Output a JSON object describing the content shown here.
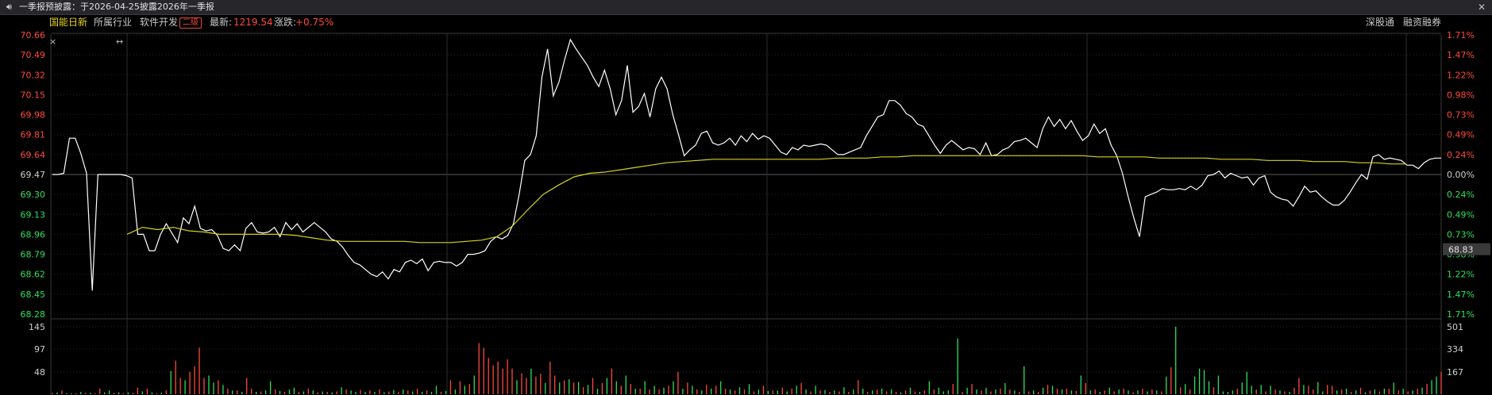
{
  "banner": {
    "speaker_icon": "speaker-icon",
    "text": "一季报预披露：于2026-04-25披露2026年一季报",
    "close_icon": "close-icon"
  },
  "info": {
    "index_name": "国能日新",
    "industry_label": "所属行业",
    "industry_value": "软件开发",
    "level_badge": "二级",
    "latest_label": "最新:",
    "latest_value": "1219.54",
    "change_label": "涨跌:",
    "change_value": "+0.75%",
    "link_sz": "深股通",
    "link_margin": "融资融券"
  },
  "colors": {
    "up": "#ff4a3a",
    "down": "#2ee05a",
    "price_line": "#ffffff",
    "avg_line": "#d6d21e",
    "grid": "#262626"
  },
  "chart_data": [
    {
      "type": "line",
      "title": "",
      "left_ticks": [
        "70.66",
        "70.49",
        "70.32",
        "70.15",
        "69.98",
        "69.81",
        "69.64",
        "69.47",
        "69.30",
        "69.13",
        "68.96",
        "68.79",
        "68.62",
        "68.45",
        "68.28"
      ],
      "right_ticks": [
        "1.71%",
        "1.47%",
        "1.22%",
        "0.98%",
        "0.73%",
        "0.49%",
        "0.24%",
        "0.00%",
        "0.24%",
        "0.49%",
        "0.73%",
        "0.98%",
        "1.22%",
        "1.47%",
        "1.71%"
      ],
      "ylim": [
        68.28,
        70.66
      ],
      "baseline": 69.47,
      "current_value": "68.83",
      "series": [
        {
          "values": [
            69.47,
            69.47,
            69.48,
            69.78,
            69.78,
            69.65,
            69.48,
            68.48,
            69.47,
            69.47,
            69.47,
            69.47,
            69.47,
            69.46,
            69.44,
            68.96,
            68.96,
            68.82,
            68.82,
            68.96,
            69.05,
            68.97,
            68.89,
            69.1,
            69.05,
            69.2,
            69.01,
            68.99,
            69.0,
            68.95,
            68.84,
            68.82,
            68.87,
            68.82,
            69.01,
            69.06,
            68.98,
            68.97,
            68.98,
            69.02,
            68.94,
            69.06,
            69.0,
            69.05,
            68.98,
            69.02,
            69.06,
            69.02,
            68.98,
            68.92,
            68.9,
            68.85,
            68.78,
            68.72,
            68.7,
            68.66,
            68.62,
            68.6,
            68.64,
            68.58,
            68.66,
            68.64,
            68.72,
            68.74,
            68.71,
            68.75,
            68.65,
            68.72,
            68.73,
            68.72,
            68.72,
            68.69,
            68.72,
            68.79,
            68.79,
            68.8,
            68.82,
            68.9,
            68.94,
            68.92,
            68.95,
            69.05,
            69.3,
            69.59,
            69.64,
            69.8,
            70.3,
            70.54,
            70.14,
            70.26,
            70.45,
            70.62,
            70.54,
            70.47,
            70.4,
            70.3,
            70.22,
            70.36,
            70.2,
            69.98,
            70.1,
            70.4,
            70.0,
            70.05,
            70.16,
            69.96,
            70.2,
            70.3,
            70.2,
            69.98,
            69.81,
            69.63,
            69.68,
            69.72,
            69.82,
            69.84,
            69.74,
            69.72,
            69.74,
            69.78,
            69.72,
            69.8,
            69.75,
            69.82,
            69.77,
            69.8,
            69.78,
            69.72,
            69.66,
            69.64,
            69.7,
            69.68,
            69.72,
            69.71,
            69.72,
            69.73,
            69.72,
            69.68,
            69.64,
            69.64,
            69.66,
            69.68,
            69.7,
            69.8,
            69.88,
            69.96,
            69.98,
            70.1,
            70.1,
            70.06,
            69.99,
            69.96,
            69.9,
            69.88,
            69.8,
            69.72,
            69.65,
            69.72,
            69.76,
            69.72,
            69.68,
            69.7,
            69.69,
            69.64,
            69.74,
            69.63,
            69.64,
            69.68,
            69.7,
            69.75,
            69.76,
            69.78,
            69.74,
            69.7,
            69.86,
            69.96,
            69.88,
            69.94,
            69.86,
            69.93,
            69.84,
            69.76,
            69.8,
            69.9,
            69.82,
            69.86,
            69.72,
            69.63,
            69.48,
            69.28,
            69.1,
            68.94,
            69.28,
            69.3,
            69.32,
            69.35,
            69.34,
            69.34,
            69.35,
            69.34,
            69.37,
            69.34,
            69.38,
            69.46,
            69.47,
            69.5,
            69.44,
            69.48,
            69.46,
            69.44,
            69.45,
            69.38,
            69.44,
            69.46,
            69.32,
            69.28,
            69.26,
            69.25,
            69.2,
            69.28,
            69.37,
            69.32,
            69.33,
            69.28,
            69.24,
            69.21,
            69.21,
            69.25,
            69.32,
            69.4,
            69.47,
            69.43,
            69.62,
            69.64,
            69.6,
            69.61,
            69.6,
            69.59,
            69.55,
            69.55,
            69.52,
            69.57,
            69.6,
            69.61,
            69.61
          ],
          "avg_values": [
            68.96,
            69.02,
            69.0,
            69.02,
            68.99,
            68.98,
            68.96,
            68.96,
            68.96,
            68.96,
            68.96,
            68.95,
            68.93,
            68.91,
            68.9,
            68.9,
            68.9,
            68.9,
            68.9,
            68.89,
            68.89,
            68.89,
            68.9,
            68.91,
            68.94,
            69.03,
            69.17,
            69.3,
            69.38,
            69.45,
            69.48,
            69.49,
            69.51,
            69.53,
            69.55,
            69.57,
            69.58,
            69.59,
            69.6,
            69.6,
            69.6,
            69.6,
            69.6,
            69.6,
            69.6,
            69.6,
            69.61,
            69.61,
            69.61,
            69.62,
            69.62,
            69.63,
            69.63,
            69.63,
            69.63,
            69.63,
            69.63,
            69.63,
            69.63,
            69.63,
            69.63,
            69.63,
            69.63,
            69.62,
            69.62,
            69.62,
            69.62,
            69.61,
            69.61,
            69.61,
            69.61,
            69.6,
            69.6,
            69.6,
            69.59,
            69.59,
            69.59,
            69.58,
            69.58,
            69.58,
            69.57,
            69.57,
            69.56,
            69.56
          ]
        }
      ]
    },
    {
      "type": "bar",
      "title": "",
      "left_ticks": [
        "145",
        "97",
        "48"
      ],
      "right_ticks": [
        "501",
        "334",
        "167"
      ],
      "ylim": [
        0,
        150
      ],
      "series": [
        {
          "values": [
            3,
            4,
            8,
            2,
            2,
            2,
            5,
            3,
            3,
            2,
            12,
            4,
            8,
            3,
            4,
            2,
            4,
            3,
            14,
            6,
            12,
            4,
            2,
            3,
            8,
            50,
            72,
            35,
            30,
            48,
            60,
            100,
            35,
            40,
            25,
            30,
            20,
            12,
            8,
            8,
            5,
            35,
            12,
            5,
            6,
            8,
            28,
            10,
            7,
            5,
            10,
            14,
            5,
            6,
            12,
            8,
            4,
            6,
            5,
            4,
            6,
            15,
            10,
            8,
            5,
            9,
            5,
            8,
            5,
            10,
            4,
            6,
            9,
            5,
            10,
            8,
            6,
            12,
            5,
            8,
            5,
            18,
            5,
            7,
            30,
            10,
            28,
            18,
            22,
            40,
            110,
            100,
            78,
            62,
            70,
            55,
            75,
            55,
            30,
            45,
            35,
            55,
            38,
            44,
            24,
            70,
            40,
            25,
            30,
            32,
            25,
            26,
            15,
            20,
            35,
            12,
            24,
            35,
            55,
            28,
            18,
            40,
            22,
            12,
            12,
            28,
            10,
            18,
            10,
            14,
            18,
            28,
            48,
            12,
            25,
            18,
            10,
            8,
            20,
            12,
            18,
            28,
            12,
            10,
            8,
            15,
            10,
            22,
            6,
            10,
            18,
            7,
            8,
            8,
            14,
            6,
            12,
            18,
            24,
            10,
            6,
            18,
            8,
            9,
            5,
            8,
            6,
            15,
            5,
            10,
            30,
            12,
            5,
            8,
            10,
            12,
            6,
            10,
            5,
            4,
            8,
            14,
            6,
            5,
            8,
            28,
            10,
            14,
            6,
            8,
            22,
            120,
            5,
            14,
            22,
            10,
            8,
            14,
            6,
            10,
            12,
            24,
            10,
            8,
            5,
            60,
            6,
            8,
            5,
            14,
            20,
            18,
            12,
            10,
            12,
            8,
            7,
            40,
            24,
            8,
            10,
            5,
            8,
            14,
            6,
            10,
            12,
            8,
            4,
            8,
            12,
            6,
            10,
            8,
            6,
            38,
            58,
            145,
            15,
            22,
            10,
            38,
            55,
            52,
            28,
            15,
            40,
            6,
            5,
            8,
            12,
            25,
            48,
            18,
            10,
            20,
            6,
            18,
            10,
            8,
            6,
            5,
            14,
            35,
            20,
            18,
            10,
            26,
            6,
            20,
            18,
            8,
            10,
            12,
            5,
            8,
            14,
            4,
            8,
            10,
            6,
            12,
            12,
            25,
            8,
            12,
            6,
            8,
            12,
            14,
            22,
            30,
            38,
            48
          ],
          "colors": [
            "u",
            "d",
            "u",
            "d",
            "d",
            "u",
            "d",
            "u",
            "d",
            "u",
            "u",
            "d",
            "d",
            "u",
            "d",
            "u",
            "d",
            "u",
            "u",
            "d",
            "u",
            "d",
            "u",
            "d",
            "u",
            "d",
            "u",
            "u",
            "d",
            "u",
            "u",
            "u",
            "u",
            "d",
            "d",
            "u",
            "d",
            "u",
            "d",
            "u",
            "d",
            "u",
            "u",
            "d",
            "u",
            "d",
            "d",
            "u",
            "d",
            "u",
            "d",
            "d",
            "u",
            "d",
            "u",
            "d",
            "u",
            "d",
            "u",
            "d",
            "u",
            "d",
            "u",
            "d",
            "d",
            "u",
            "d",
            "u",
            "d",
            "u",
            "d",
            "u",
            "d",
            "u",
            "d",
            "u",
            "d",
            "u",
            "d",
            "u",
            "d",
            "d",
            "u",
            "d",
            "u",
            "d",
            "u",
            "d",
            "u",
            "d",
            "u",
            "u",
            "u",
            "u",
            "u",
            "u",
            "u",
            "u",
            "d",
            "u",
            "u",
            "d",
            "u",
            "u",
            "d",
            "u",
            "u",
            "d",
            "u",
            "d",
            "u",
            "d",
            "u",
            "d",
            "u",
            "d",
            "u",
            "d",
            "u",
            "d",
            "u",
            "d",
            "u",
            "d",
            "u",
            "d",
            "u",
            "d",
            "u",
            "d",
            "u",
            "d",
            "u",
            "d",
            "u",
            "d",
            "u",
            "d",
            "u",
            "d",
            "u",
            "d",
            "u",
            "d",
            "u",
            "d",
            "u",
            "d",
            "u",
            "d",
            "u",
            "d",
            "u",
            "d",
            "u",
            "d",
            "u",
            "d",
            "u",
            "d",
            "u",
            "d",
            "u",
            "d",
            "u",
            "d",
            "u",
            "d",
            "u",
            "d",
            "u",
            "d",
            "u",
            "d",
            "u",
            "d",
            "u",
            "d",
            "u",
            "d",
            "u",
            "d",
            "u",
            "d",
            "u",
            "d",
            "u",
            "d",
            "d",
            "d",
            "u",
            "d",
            "u",
            "d",
            "u",
            "d",
            "u",
            "d",
            "u",
            "d",
            "u",
            "d",
            "u",
            "d",
            "u",
            "d",
            "u",
            "d",
            "u",
            "d",
            "u",
            "d",
            "u",
            "d",
            "u",
            "d",
            "u",
            "d",
            "u",
            "d",
            "u",
            "d",
            "u",
            "d",
            "u",
            "d",
            "u",
            "d",
            "u",
            "d",
            "u",
            "d",
            "u",
            "d",
            "u",
            "d",
            "u",
            "d",
            "u",
            "d",
            "u",
            "d",
            "d",
            "d",
            "d",
            "u",
            "d",
            "d",
            "d",
            "d",
            "u",
            "d",
            "d",
            "d",
            "u",
            "d",
            "u",
            "d",
            "u",
            "d",
            "u",
            "d",
            "u",
            "u",
            "d",
            "u",
            "u",
            "d",
            "d",
            "u",
            "u",
            "d",
            "u",
            "d",
            "u",
            "d",
            "u",
            "d",
            "u",
            "d",
            "u",
            "d",
            "u",
            "d",
            "u",
            "d",
            "u",
            "d",
            "u",
            "d",
            "u",
            "d",
            "d",
            "u",
            "u",
            "d",
            "d",
            "d",
            "d",
            "d",
            "d",
            "d",
            "d",
            "u"
          ]
        }
      ]
    }
  ]
}
